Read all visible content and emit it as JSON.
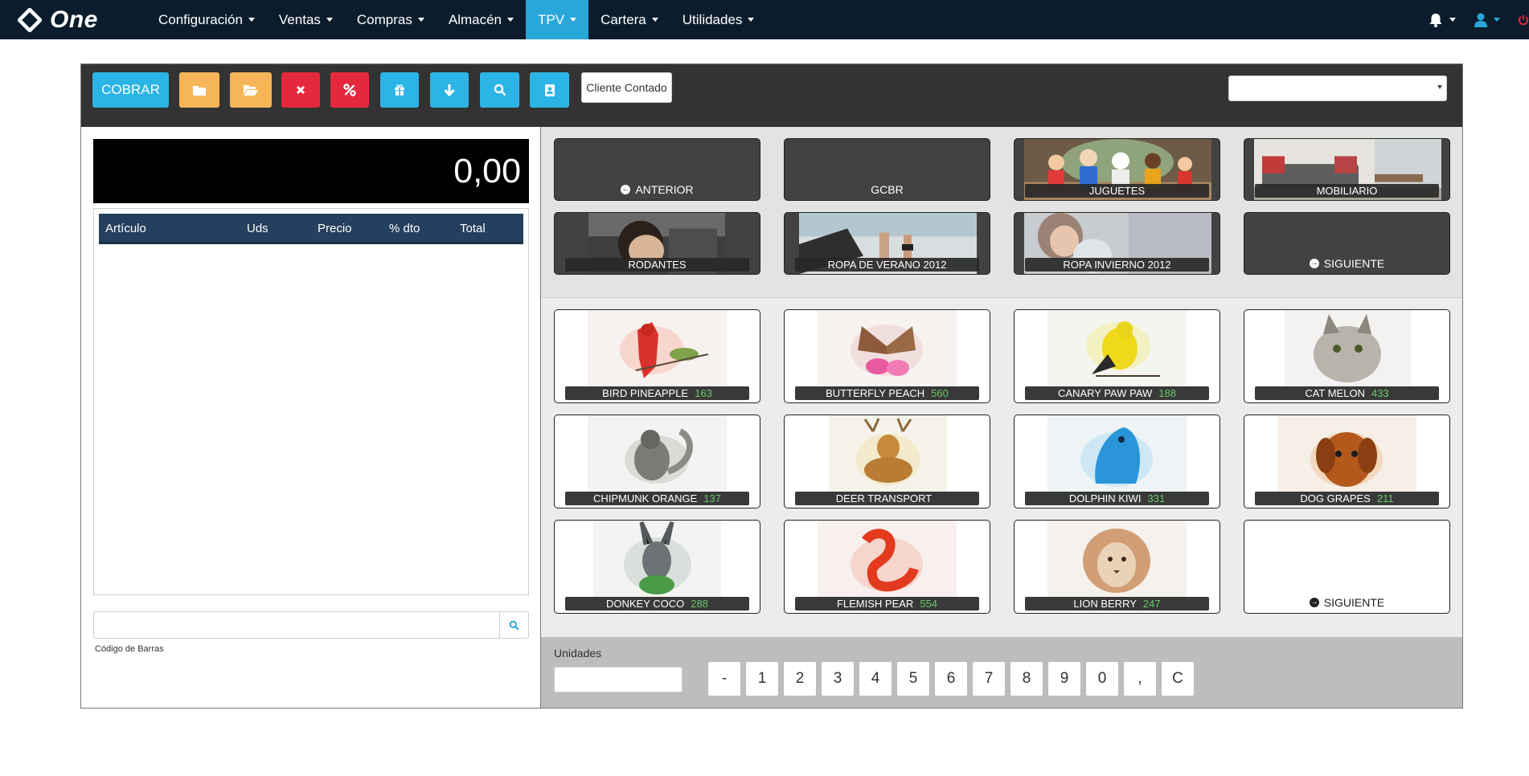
{
  "brand": {
    "name": "One"
  },
  "nav": {
    "menus": [
      {
        "label": "Configuración"
      },
      {
        "label": "Ventas"
      },
      {
        "label": "Compras"
      },
      {
        "label": "Almacén"
      },
      {
        "label": "TPV"
      },
      {
        "label": "Cartera"
      },
      {
        "label": "Utilidades"
      }
    ],
    "active_menu": "TPV",
    "icons": [
      "bell-icon",
      "user-icon",
      "power-icon"
    ]
  },
  "toolbar": {
    "cobrar_label": "COBRAR",
    "client_label": "Cliente Contado",
    "select_value": "",
    "buttons": [
      "folder-icon",
      "folder-open-icon",
      "times-icon",
      "percent-icon",
      "gift-icon",
      "arrow-down-icon",
      "search-icon",
      "contact-icon"
    ]
  },
  "ticket": {
    "total": "0,00",
    "columns": [
      "Artículo",
      "Uds",
      "Precio",
      "% dto",
      "Total"
    ],
    "rows": [],
    "barcode_value": "",
    "barcode_label": "Código de Barras"
  },
  "categories": {
    "tiles": [
      {
        "label": "ANTERIOR"
      },
      {
        "label": "GCBR"
      },
      {
        "label": "JUGUETES"
      },
      {
        "label": "MOBILIARIO"
      },
      {
        "label": "RODANTES"
      },
      {
        "label": "ROPA DE VERANO 2012"
      },
      {
        "label": "ROPA INVIERNO 2012"
      },
      {
        "label": "SIGUIENTE"
      }
    ]
  },
  "products": {
    "items": [
      {
        "name": "BIRD PINEAPPLE",
        "stock": "163"
      },
      {
        "name": "BUTTERFLY PEACH",
        "stock": "560"
      },
      {
        "name": "CANARY PAW PAW",
        "stock": "188"
      },
      {
        "name": "CAT MELON",
        "stock": "433"
      },
      {
        "name": "CHIPMUNK ORANGE",
        "stock": "137"
      },
      {
        "name": "DEER TRANSPORT",
        "stock": ""
      },
      {
        "name": "DOLPHIN KIWI",
        "stock": "331"
      },
      {
        "name": "DOG GRAPES",
        "stock": "211"
      },
      {
        "name": "DONKEY COCO",
        "stock": "288"
      },
      {
        "name": "FLEMISH PEAR",
        "stock": "554"
      },
      {
        "name": "LION BERRY",
        "stock": "247"
      }
    ],
    "next_label": "SIGUIENTE"
  },
  "units": {
    "label": "Unidades",
    "value": "",
    "keys": [
      "-",
      "1",
      "2",
      "3",
      "4",
      "5",
      "6",
      "7",
      "8",
      "9",
      "0",
      ",",
      "C"
    ]
  },
  "colors": {
    "nav_bg": "#0b1d2c",
    "accent": "#2aa7d9",
    "orange": "#f6b657",
    "red": "#e6283c",
    "toolbar_bg": "#333333",
    "ticket_header": "#24405e",
    "stock_green": "#6bc86b"
  }
}
